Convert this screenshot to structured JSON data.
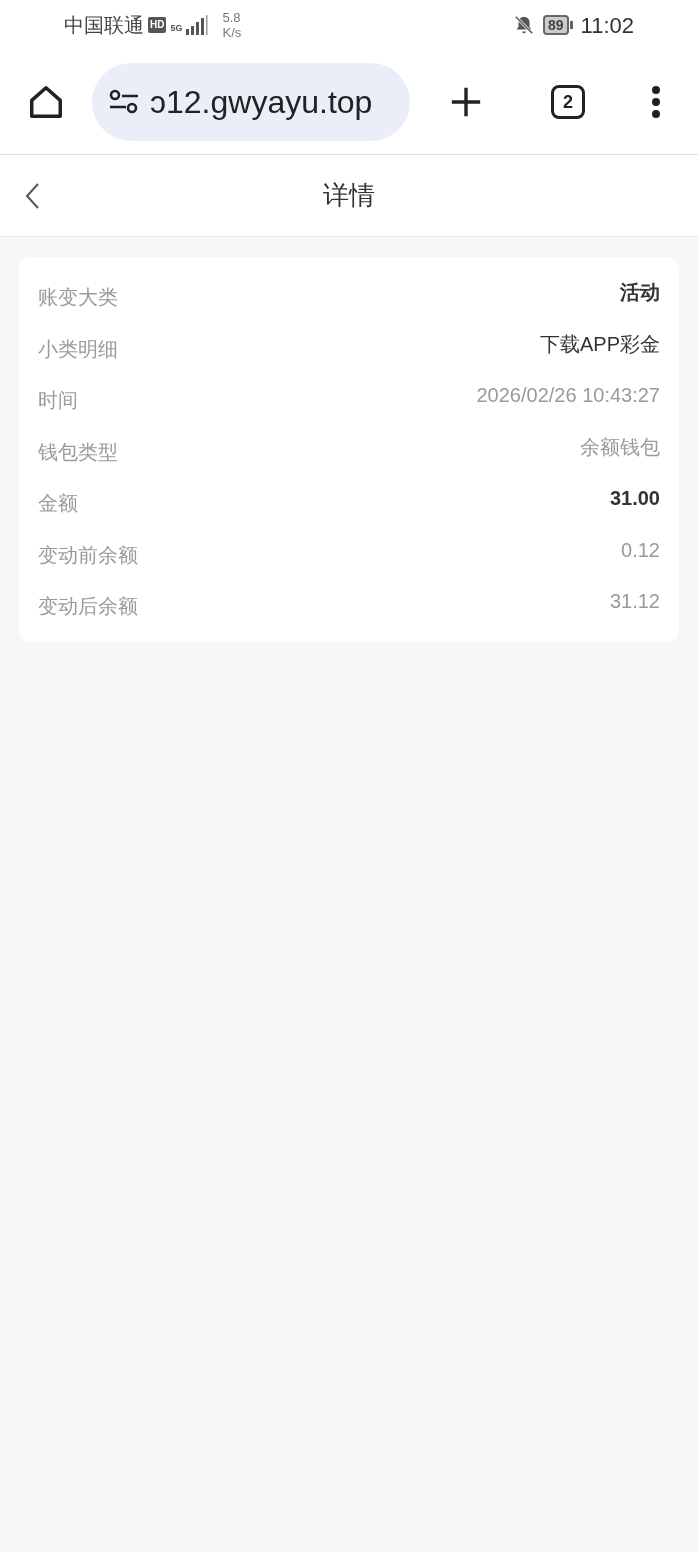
{
  "status_bar": {
    "carrier": "中国联通",
    "hd_badge": "HD",
    "network": "5G",
    "speed_value": "5.8",
    "speed_unit": "K/s",
    "battery": "89",
    "time": "11:02"
  },
  "browser": {
    "url_visible": "ɔ12.gwyayu.top",
    "tab_count": "2"
  },
  "header": {
    "title": "详情"
  },
  "details": [
    {
      "label": "账变大类",
      "value": "活动",
      "kind": "strong"
    },
    {
      "label": "小类明细",
      "value": "下载APP彩金",
      "kind": "normal"
    },
    {
      "label": "时间",
      "value": "2026/02/26 10:43:27",
      "kind": "muted"
    },
    {
      "label": "钱包类型",
      "value": "余额钱包",
      "kind": "muted"
    },
    {
      "label": "金额",
      "value": "31.00",
      "kind": "strong"
    },
    {
      "label": "变动前余额",
      "value": "0.12",
      "kind": "muted"
    },
    {
      "label": "变动后余额",
      "value": "31.12",
      "kind": "muted"
    }
  ]
}
